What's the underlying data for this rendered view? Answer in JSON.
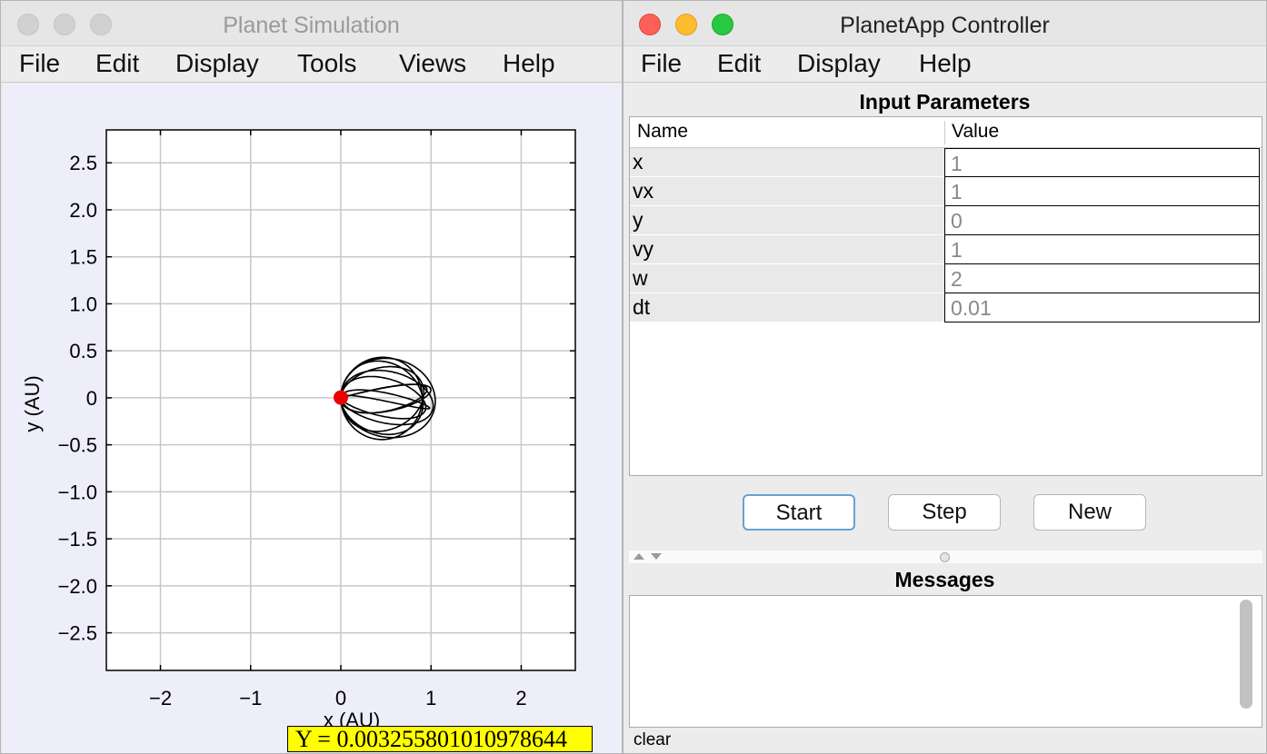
{
  "sim_window": {
    "title": "Planet Simulation",
    "menu": [
      "File",
      "Edit",
      "Display",
      "Tools",
      "Views",
      "Help"
    ],
    "readout": "Y = 0.003255801010978644"
  },
  "ctrl_window": {
    "title": "PlanetApp Controller",
    "menu": [
      "File",
      "Edit",
      "Display",
      "Help"
    ],
    "input_title": "Input Parameters",
    "table": {
      "headers": [
        "Name",
        "Value"
      ],
      "rows": [
        {
          "name": "x",
          "value": "1"
        },
        {
          "name": "vx",
          "value": "1"
        },
        {
          "name": "y",
          "value": "0"
        },
        {
          "name": "vy",
          "value": "1"
        },
        {
          "name": "w",
          "value": "2"
        },
        {
          "name": "dt",
          "value": "0.01"
        }
      ]
    },
    "buttons": {
      "start": "Start",
      "step": "Step",
      "new": "New"
    },
    "messages_title": "Messages",
    "clear_label": "clear"
  },
  "colors": {
    "traffic_close": "#fe5f57",
    "traffic_minimize": "#febc2e",
    "traffic_zoom": "#28c840",
    "traffic_inactive": "#d1d1d1",
    "planet": "#ee0000",
    "plot_background": "#eeeefb",
    "readout_background": "#ffff00"
  },
  "chart_data": {
    "type": "line",
    "xlabel": "x (AU)",
    "ylabel": "y (AU)",
    "xlim": [
      -2.6,
      2.6
    ],
    "ylim": [
      -2.9,
      2.85
    ],
    "xticks": [
      -2,
      -1,
      0,
      1,
      2
    ],
    "xtick_labels": [
      "−2",
      "−1",
      "0",
      "1",
      "2"
    ],
    "yticks": [
      2.5,
      2.0,
      1.5,
      1.0,
      0.5,
      0,
      -0.5,
      -1.0,
      -1.5,
      -2.0,
      -2.5
    ],
    "ytick_labels": [
      "2.5",
      "2.0",
      "1.5",
      "1.0",
      "0.5",
      "0",
      "−0.5",
      "−1.0",
      "−1.5",
      "−2.0",
      "−2.5"
    ],
    "grid": true,
    "planet": {
      "x": 0.0,
      "y": 0.0033
    },
    "trajectory": {
      "x_max": 1.05,
      "y_max": 0.45,
      "y_min": -0.47,
      "loops": 9
    }
  }
}
